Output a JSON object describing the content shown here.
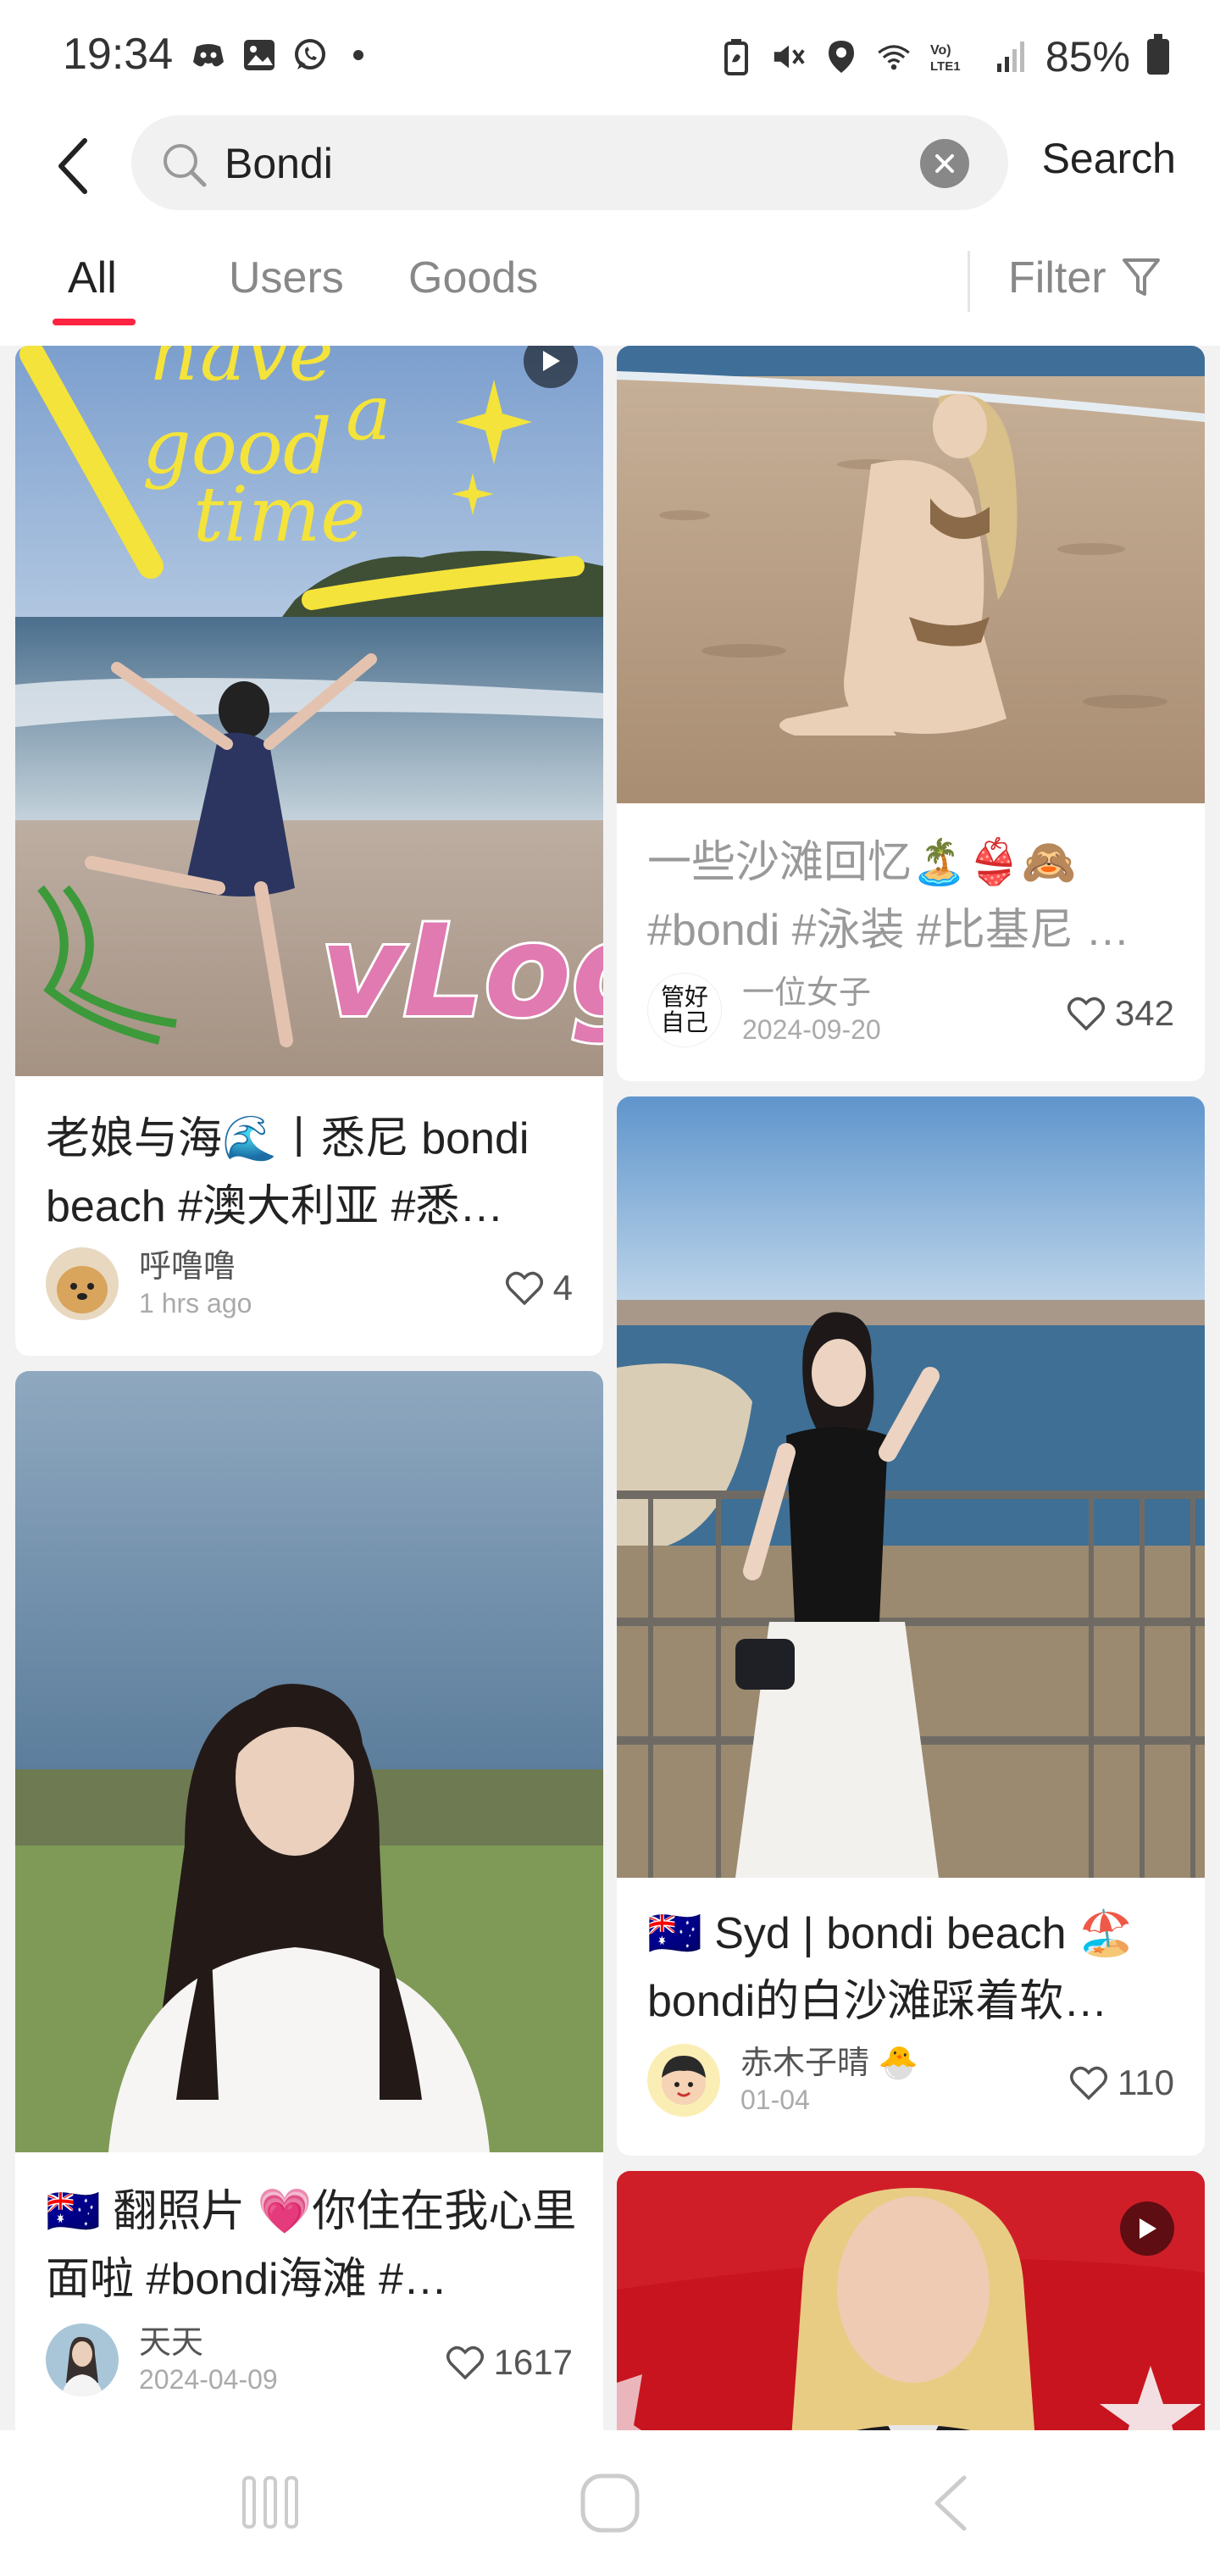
{
  "status": {
    "time": "19:34",
    "battery": "85%"
  },
  "search": {
    "value": "Bondi",
    "search_label": "Search"
  },
  "tabs": [
    {
      "label": "All"
    },
    {
      "label": "Users"
    },
    {
      "label": "Goods"
    }
  ],
  "filter_label": "Filter",
  "posts": [
    {
      "caption": "老娘与海🌊丨悉尼 bondi beach #澳大利亚 #悉…",
      "author": "呼噜噜",
      "date": "1 hrs ago",
      "likes": "4",
      "image_text": "have a good time   vLog",
      "has_video": true
    },
    {
      "caption": "一些沙滩回忆🏝️👙🙈 #bondi #泳装 #比基尼 …",
      "author": "一位女子",
      "date": "2024-09-20",
      "likes": "342",
      "avatar_text": "管好自己"
    },
    {
      "caption": "🇦🇺 Syd | bondi beach 🏖️ bondi的白沙滩踩着软…",
      "author": "赤木子晴 🐣",
      "date": "01-04",
      "likes": "110"
    },
    {
      "caption": "🇦🇺 翻照片 💗你住在我心里面啦 #bondi海滩 #…",
      "author": "天天",
      "date": "2024-04-09",
      "likes": "1617"
    },
    {
      "has_video": true
    }
  ],
  "icons": {
    "back": "back-chevron-icon",
    "search": "search-icon",
    "clear": "clear-icon",
    "filter": "filter-funnel-icon",
    "like": "heart-icon",
    "play": "play-icon"
  }
}
